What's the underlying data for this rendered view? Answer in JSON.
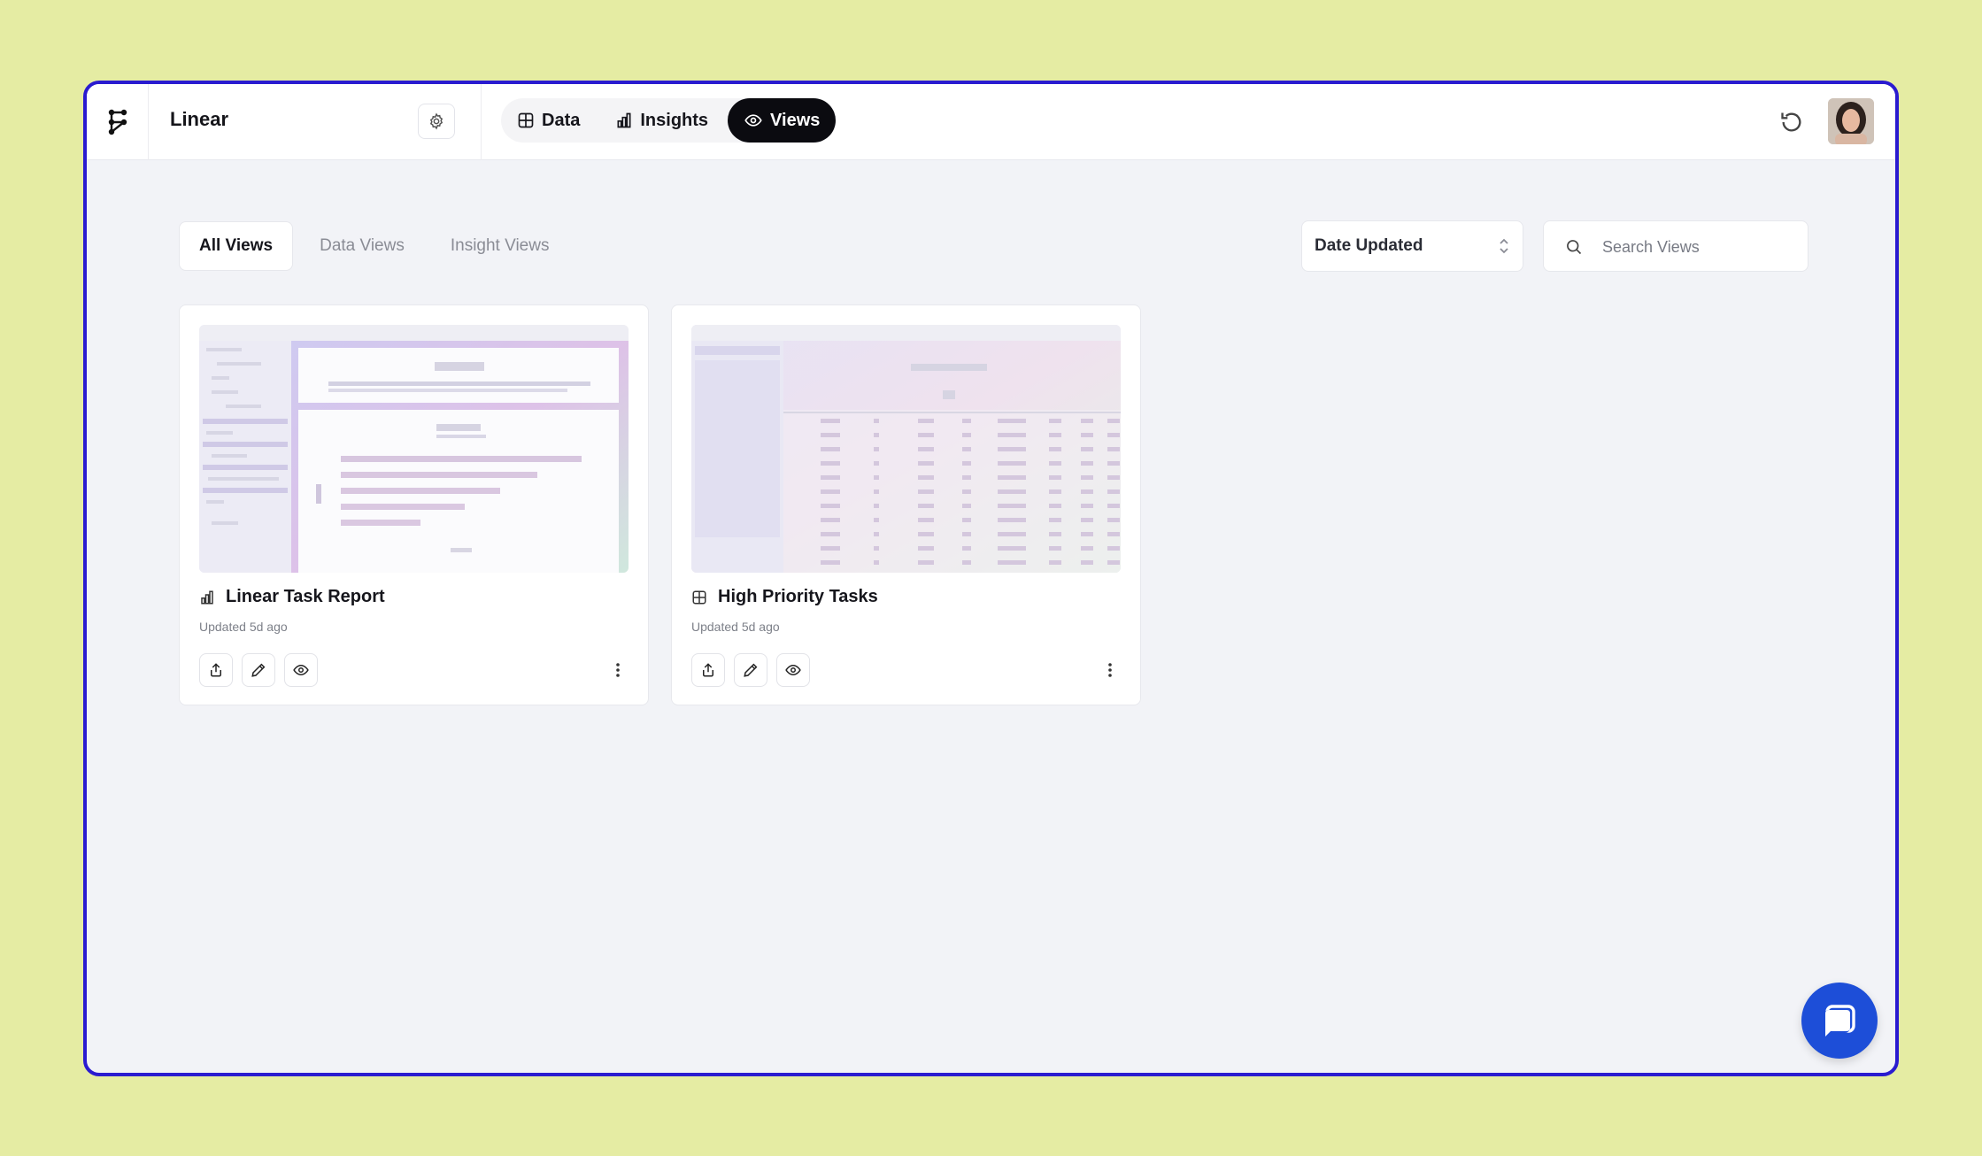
{
  "app": {
    "workspace_name": "Linear",
    "icons": {
      "logo": "app-logo-icon",
      "settings": "gear-icon",
      "refresh": "refresh-icon",
      "avatar": "user-avatar"
    }
  },
  "nav": {
    "tabs": [
      {
        "label": "Data",
        "icon": "table-grid-icon",
        "active": false
      },
      {
        "label": "Insights",
        "icon": "bar-chart-icon",
        "active": false
      },
      {
        "label": "Views",
        "icon": "eye-icon",
        "active": true
      }
    ]
  },
  "views_toolbar": {
    "tabs": [
      {
        "label": "All Views",
        "active": true
      },
      {
        "label": "Data Views",
        "active": false
      },
      {
        "label": "Insight Views",
        "active": false
      }
    ],
    "sort_value": "Date Updated",
    "search_placeholder": "Search Views"
  },
  "cards": [
    {
      "title": "Linear Task Report",
      "type_icon": "bar-chart-icon",
      "updated": "Updated 5d ago"
    },
    {
      "title": "High Priority Tasks",
      "type_icon": "table-grid-icon",
      "updated": "Updated 5d ago"
    }
  ],
  "card_actions": [
    "share-icon",
    "edit-pencil-icon",
    "eye-icon",
    "more-vertical-icon"
  ],
  "colors": {
    "background": "#e5eca3",
    "window_border": "#2a1bd0",
    "accent": "#1d4ed8",
    "active_tab": "#0b0b10"
  },
  "chat": {
    "icon": "chat-bubble-icon"
  }
}
